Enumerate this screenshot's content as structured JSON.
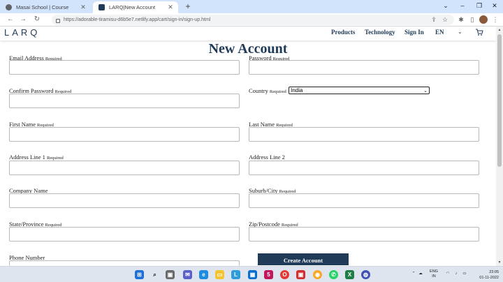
{
  "browser": {
    "tabs": [
      {
        "title": "Masai School | Course",
        "active": false
      },
      {
        "title": "LARQ|New Account",
        "active": true
      }
    ],
    "url": "https://adorable-tiramisu-d6b5e7.netlify.app/cart/sign-in/sign-up.html"
  },
  "site": {
    "logo": "LARQ",
    "nav": [
      "Products",
      "Technology",
      "Sign In",
      "EN"
    ]
  },
  "page": {
    "title": "New Account",
    "required_tag": "Required",
    "fields": {
      "email": "Email Address",
      "password": "Password",
      "confirm_password": "Confirm Password",
      "country": "Country",
      "first_name": "First Name",
      "last_name": "Last Name",
      "address1": "Address Line 1",
      "address2": "Address Line 2",
      "company": "Company Name",
      "city": "Suburb/City",
      "state": "State/Province",
      "zip": "Zip/Postcode",
      "phone": "Phone Number"
    },
    "country_value": "India",
    "submit_label": "Create Account"
  },
  "taskbar": {
    "lang": "ENG",
    "region": "IN",
    "time": "23:05",
    "date": "01-11-2022",
    "mail_badge": "5"
  },
  "colors": {
    "brand": "#1f3b57",
    "tabstrip": "#d2e3fc",
    "taskbar": "#dfe5ee"
  }
}
